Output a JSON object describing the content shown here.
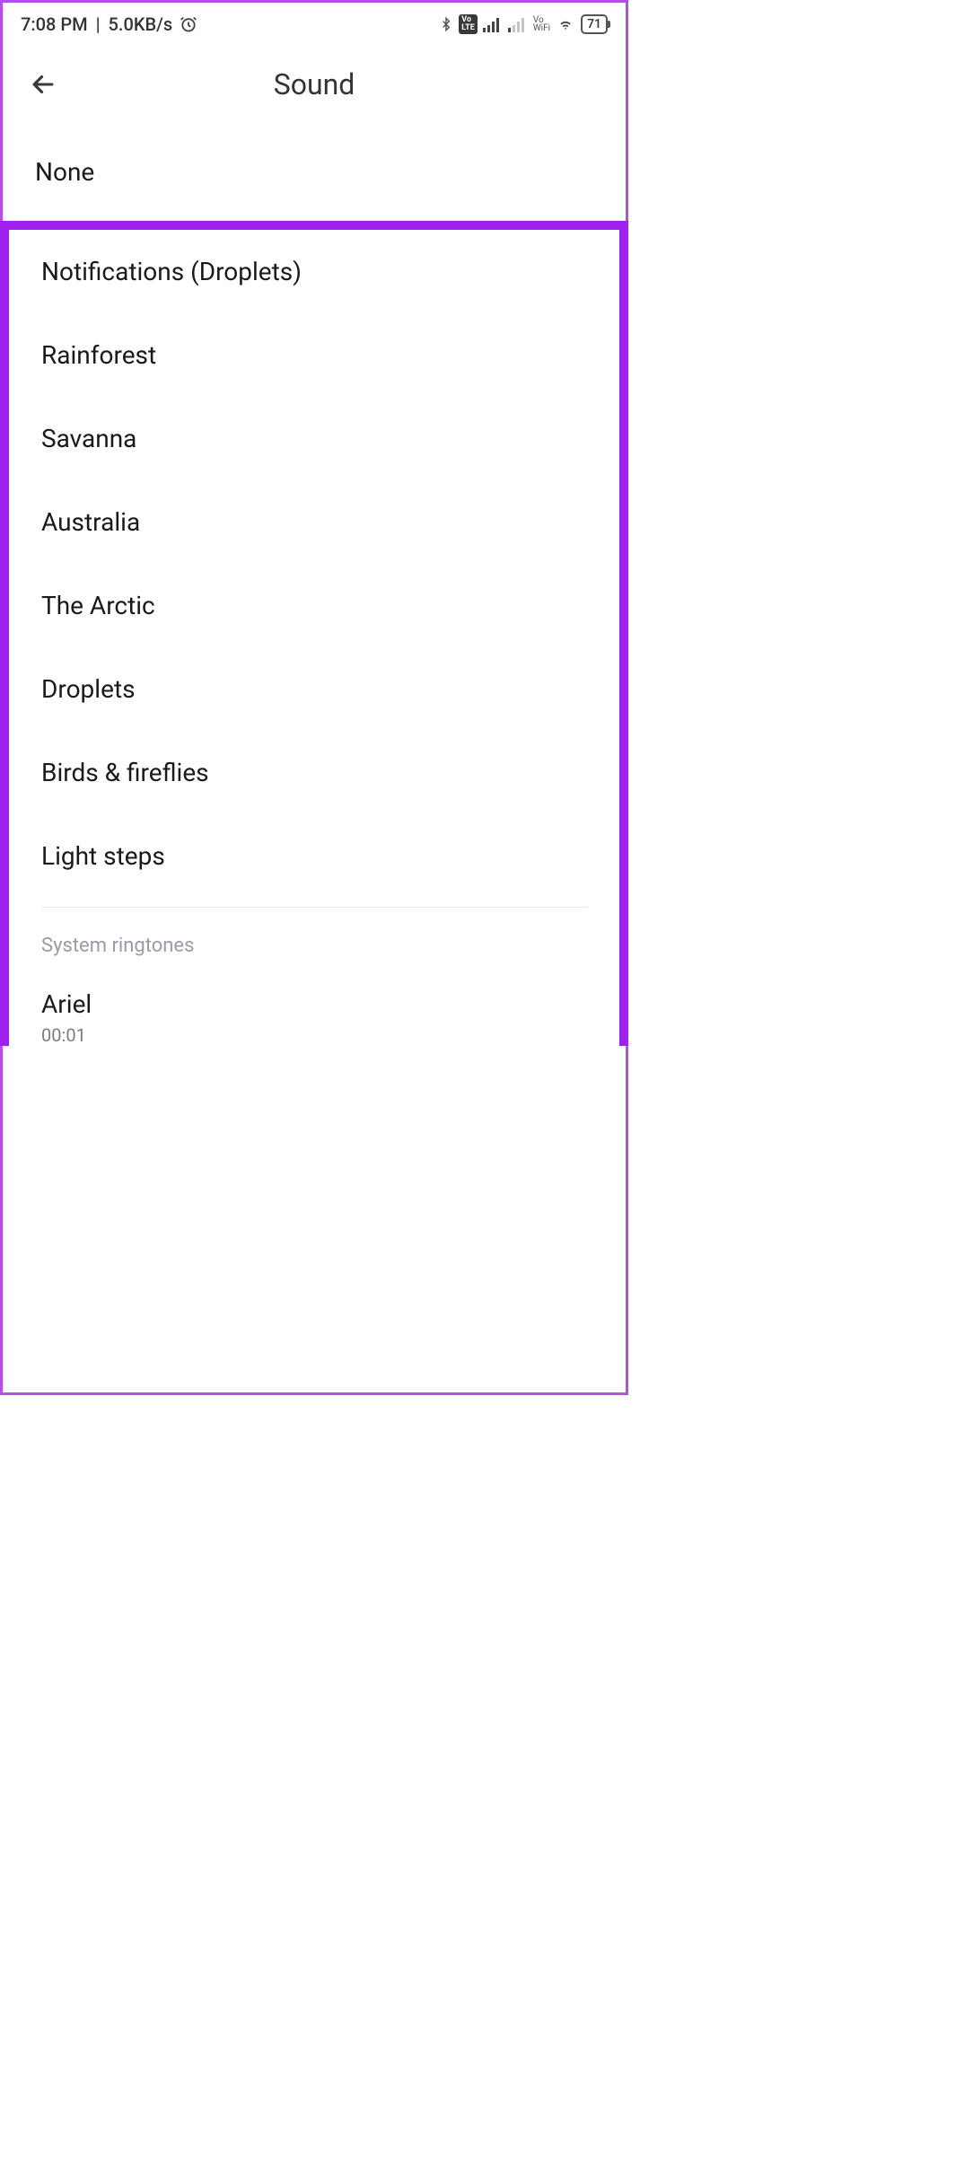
{
  "statusBar": {
    "time": "7:08 PM",
    "networkSpeed": "5.0KB/s",
    "battery": "71"
  },
  "header": {
    "title": "Sound"
  },
  "noneOption": "None",
  "sounds": [
    "Notifications (Droplets)",
    "Rainforest",
    "Savanna",
    "Australia",
    "The Arctic",
    "Droplets",
    "Birds & fireflies",
    "Light steps"
  ],
  "sectionHeader": "System ringtones",
  "ringtones": [
    {
      "name": "Ariel",
      "duration": "00:01"
    }
  ]
}
